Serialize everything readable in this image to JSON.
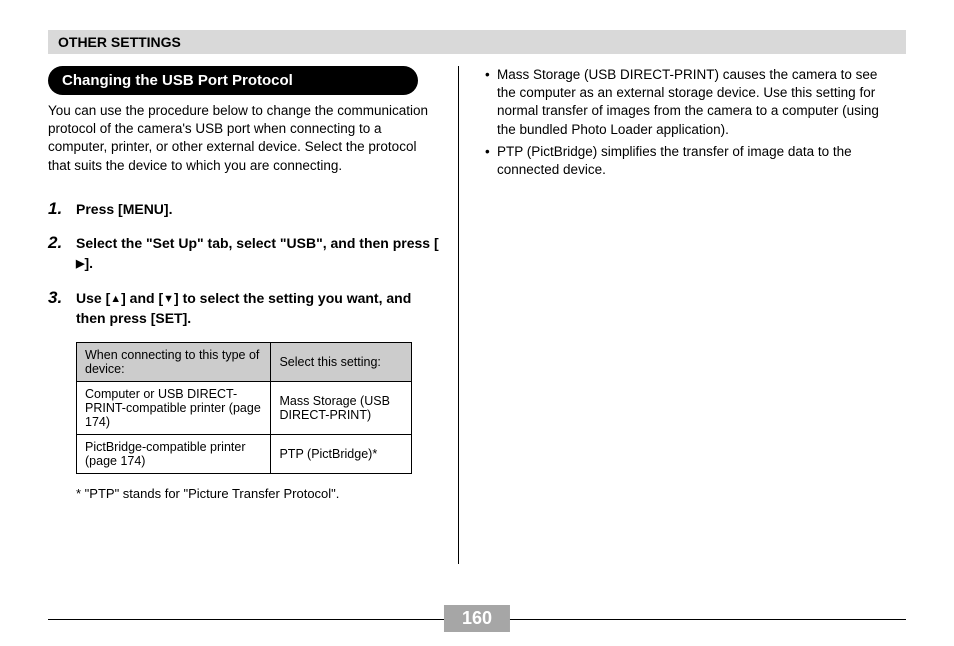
{
  "header": {
    "title": "OTHER SETTINGS"
  },
  "section": {
    "heading": "Changing the USB Port Protocol",
    "intro": "You can use the procedure below to change the communication protocol of the camera's USB port when connecting to a computer, printer, or other external device. Select the protocol that suits the device to which you are connecting."
  },
  "steps": [
    {
      "num": "1.",
      "text": "Press [MENU]."
    },
    {
      "num": "2.",
      "text_a": "Select the \"Set Up\" tab, select \"USB\", and then press [",
      "text_b": "]."
    },
    {
      "num": "3.",
      "text_a": "Use [",
      "text_mid": "] and [",
      "text_b": "] to select the setting you want, and then press [SET]."
    }
  ],
  "table": {
    "h1": "When connecting to this type of device:",
    "h2": "Select this setting:",
    "rows": [
      {
        "c1": "Computer or USB DIRECT-PRINT-compatible printer (page 174)",
        "c2": "Mass Storage (USB DIRECT-PRINT)"
      },
      {
        "c1": "PictBridge-compatible printer (page 174)",
        "c2": "PTP (PictBridge)*"
      }
    ]
  },
  "footnote": "* \"PTP\" stands for \"Picture Transfer Protocol\".",
  "bullets": [
    "Mass Storage (USB DIRECT-PRINT) causes the camera to see the computer as an external storage device. Use this setting for normal transfer of images from the camera to a computer (using the bundled Photo Loader application).",
    "PTP (PictBridge) simplifies the transfer of image data to the connected device."
  ],
  "page_number": "160",
  "glyph": {
    "right": "▶",
    "up": "▲",
    "down": "▼"
  }
}
